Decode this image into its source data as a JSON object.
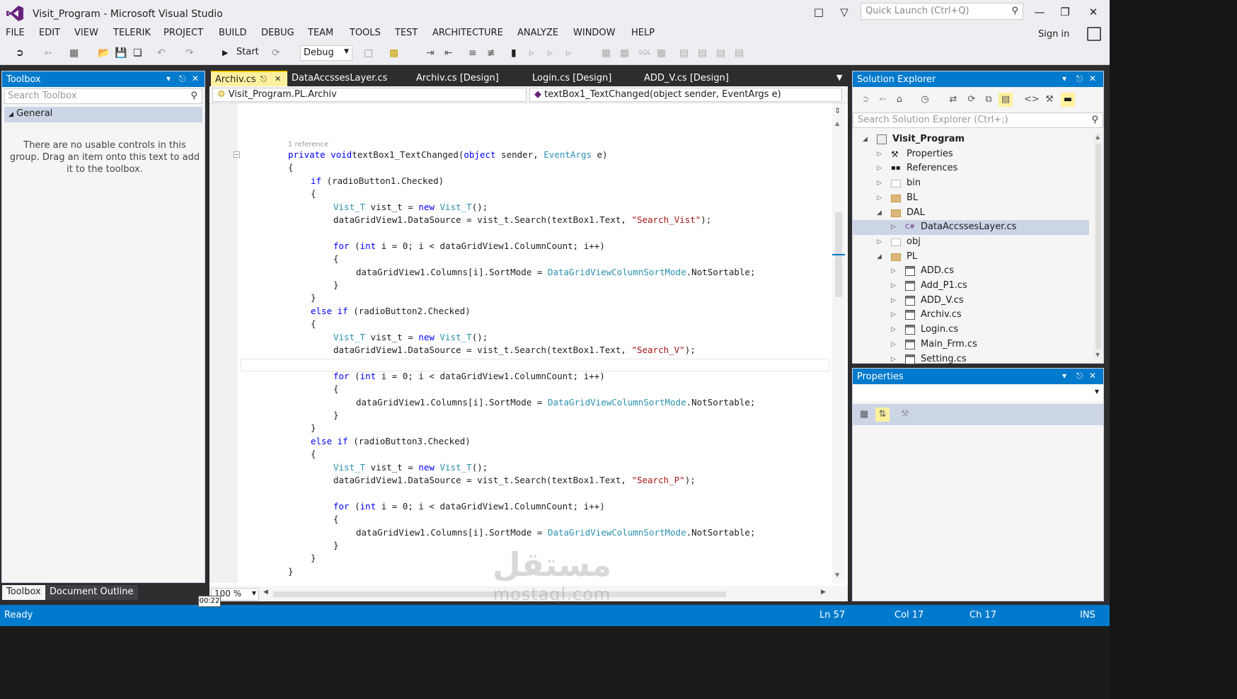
{
  "window": {
    "title": "Visit_Program - Microsoft Visual Studio",
    "quick_launch_placeholder": "Quick Launch (Ctrl+Q)",
    "sign_in": "Sign in"
  },
  "menu": [
    "FILE",
    "EDIT",
    "VIEW",
    "TELERIK",
    "PROJECT",
    "BUILD",
    "DEBUG",
    "TEAM",
    "TOOLS",
    "TEST",
    "ARCHITECTURE",
    "ANALYZE",
    "WINDOW",
    "HELP"
  ],
  "toolbar": {
    "start_label": "Start",
    "configuration": "Debug"
  },
  "toolbox": {
    "title": "Toolbox",
    "search_placeholder": "Search Toolbox",
    "group": "General",
    "empty_message": "There are no usable controls in this group. Drag an item onto this text to add it to the toolbox.",
    "bottom_tabs": [
      "Toolbox",
      "Document Outline"
    ]
  },
  "editor": {
    "tabs": [
      "Archiv.cs",
      "DataAccssesLayer.cs",
      "Archiv.cs [Design]",
      "Login.cs [Design]",
      "ADD_V.cs [Design]"
    ],
    "nav_left": "Visit_Program.PL.Archiv",
    "nav_right": "textBox1_TextChanged(object sender, EventArgs e)",
    "zoom": "100 %",
    "reference_hint": "1 reference"
  },
  "solution_explorer": {
    "title": "Solution Explorer",
    "search_placeholder": "Search Solution Explorer (Ctrl+;)",
    "items": [
      {
        "label": "Visit_Program",
        "level": 0,
        "kind": "solution",
        "state": "open"
      },
      {
        "label": "Properties",
        "level": 1,
        "kind": "wrench",
        "state": "closed"
      },
      {
        "label": "References",
        "level": 1,
        "kind": "refs",
        "state": "closed"
      },
      {
        "label": "bin",
        "level": 1,
        "kind": "folder-empty",
        "state": "closed"
      },
      {
        "label": "BL",
        "level": 1,
        "kind": "folder",
        "state": "closed"
      },
      {
        "label": "DAL",
        "level": 1,
        "kind": "folder-open",
        "state": "open"
      },
      {
        "label": "DataAccssesLayer.cs",
        "level": 2,
        "kind": "cs",
        "state": "closed"
      },
      {
        "label": "obj",
        "level": 1,
        "kind": "folder-empty",
        "state": "closed"
      },
      {
        "label": "PL",
        "level": 1,
        "kind": "folder-open",
        "state": "open"
      },
      {
        "label": "ADD.cs",
        "level": 2,
        "kind": "form",
        "state": "closed"
      },
      {
        "label": "Add_P1.cs",
        "level": 2,
        "kind": "form",
        "state": "closed"
      },
      {
        "label": "ADD_V.cs",
        "level": 2,
        "kind": "form",
        "state": "closed"
      },
      {
        "label": "Archiv.cs",
        "level": 2,
        "kind": "form",
        "state": "closed"
      },
      {
        "label": "Login.cs",
        "level": 2,
        "kind": "form",
        "state": "closed"
      },
      {
        "label": "Main_Frm.cs",
        "level": 2,
        "kind": "form",
        "state": "closed"
      },
      {
        "label": "Setting.cs",
        "level": 2,
        "kind": "form",
        "state": "closed"
      }
    ]
  },
  "properties": {
    "title": "Properties"
  },
  "status": {
    "ready": "Ready",
    "ln": "Ln 57",
    "col": "Col 17",
    "ch": "Ch 17",
    "mode": "INS",
    "timer": "00:22"
  },
  "watermark": {
    "arabic": "مستقل",
    "latin": "mostaql.com"
  },
  "colors": {
    "accent": "#007acc",
    "active_tab": "#fff0a0",
    "keyword": "#0000ff",
    "type": "#2b91af",
    "string": "#a31515"
  },
  "code_lines": [
    {
      "indent": 0,
      "segs": [
        [
          "k",
          "private"
        ],
        [
          "",
          ""
        ],
        [
          "k",
          "void"
        ],
        [
          "",
          "textBox1_TextChanged("
        ],
        [
          "k",
          "object"
        ],
        [
          "",
          " sender, "
        ],
        [
          "t",
          "EventArgs"
        ],
        [
          "",
          " e)"
        ]
      ]
    },
    {
      "indent": 0,
      "segs": [
        [
          "",
          "{"
        ]
      ]
    },
    {
      "indent": 1,
      "segs": [
        [
          "k",
          "if"
        ],
        [
          "",
          " (radioButton1.Checked)"
        ]
      ]
    },
    {
      "indent": 1,
      "segs": [
        [
          "",
          "{"
        ]
      ]
    },
    {
      "indent": 2,
      "segs": [
        [
          "t",
          "Vist_T"
        ],
        [
          "",
          " vist_t = "
        ],
        [
          "k",
          "new"
        ],
        [
          "",
          ""
        ],
        [
          "t",
          "Vist_T"
        ],
        [
          "",
          "();"
        ]
      ]
    },
    {
      "indent": 2,
      "segs": [
        [
          "",
          "dataGridView1.DataSource = vist_t.Search(textBox1.Text, "
        ],
        [
          "s",
          "\"Search_Vist\""
        ],
        [
          "",
          ");"
        ]
      ]
    },
    {
      "indent": 0,
      "segs": []
    },
    {
      "indent": 2,
      "segs": [
        [
          "k",
          "for"
        ],
        [
          "",
          " ("
        ],
        [
          "k",
          "int"
        ],
        [
          "",
          " i = 0; i < dataGridView1.ColumnCount; i++)"
        ]
      ]
    },
    {
      "indent": 2,
      "segs": [
        [
          "",
          "{"
        ]
      ]
    },
    {
      "indent": 3,
      "segs": [
        [
          "",
          "dataGridView1.Columns[i].SortMode = "
        ],
        [
          "t",
          "DataGridViewColumnSortMode"
        ],
        [
          "",
          ".NotSortable;"
        ]
      ]
    },
    {
      "indent": 2,
      "segs": [
        [
          "",
          "}"
        ]
      ]
    },
    {
      "indent": 1,
      "segs": [
        [
          "",
          "}"
        ]
      ]
    },
    {
      "indent": 1,
      "segs": [
        [
          "k",
          "else if"
        ],
        [
          "",
          " (radioButton2.Checked)"
        ]
      ]
    },
    {
      "indent": 1,
      "segs": [
        [
          "",
          "{"
        ]
      ]
    },
    {
      "indent": 2,
      "segs": [
        [
          "t",
          "Vist_T"
        ],
        [
          "",
          " vist_t = "
        ],
        [
          "k",
          "new"
        ],
        [
          "",
          ""
        ],
        [
          "t",
          "Vist_T"
        ],
        [
          "",
          "();"
        ]
      ]
    },
    {
      "indent": 2,
      "segs": [
        [
          "",
          "dataGridView1.DataSource = vist_t.Search(textBox1.Text, "
        ],
        [
          "s",
          "\"Search_V\""
        ],
        [
          "",
          ");"
        ]
      ]
    },
    {
      "indent": 0,
      "segs": []
    },
    {
      "indent": 2,
      "segs": [
        [
          "k",
          "for"
        ],
        [
          "",
          " ("
        ],
        [
          "k",
          "int"
        ],
        [
          "",
          " i = 0; i < dataGridView1.ColumnCount; i++)"
        ]
      ]
    },
    {
      "indent": 2,
      "segs": [
        [
          "",
          "{"
        ]
      ]
    },
    {
      "indent": 3,
      "segs": [
        [
          "",
          "dataGridView1.Columns[i].SortMode = "
        ],
        [
          "t",
          "DataGridViewColumnSortMode"
        ],
        [
          "",
          ".NotSortable;"
        ]
      ]
    },
    {
      "indent": 2,
      "segs": [
        [
          "",
          "}"
        ]
      ]
    },
    {
      "indent": 1,
      "segs": [
        [
          "",
          "}"
        ]
      ]
    },
    {
      "indent": 1,
      "segs": [
        [
          "k",
          "else if"
        ],
        [
          "",
          " (radioButton3.Checked)"
        ]
      ]
    },
    {
      "indent": 1,
      "segs": [
        [
          "",
          "{"
        ]
      ]
    },
    {
      "indent": 2,
      "segs": [
        [
          "t",
          "Vist_T"
        ],
        [
          "",
          " vist_t = "
        ],
        [
          "k",
          "new"
        ],
        [
          "",
          ""
        ],
        [
          "t",
          "Vist_T"
        ],
        [
          "",
          "();"
        ]
      ]
    },
    {
      "indent": 2,
      "segs": [
        [
          "",
          "dataGridView1.DataSource = vist_t.Search(textBox1.Text, "
        ],
        [
          "s",
          "\"Search_P\""
        ],
        [
          "",
          ");"
        ]
      ]
    },
    {
      "indent": 0,
      "segs": []
    },
    {
      "indent": 2,
      "segs": [
        [
          "k",
          "for"
        ],
        [
          "",
          " ("
        ],
        [
          "k",
          "int"
        ],
        [
          "",
          " i = 0; i < dataGridView1.ColumnCount; i++)"
        ]
      ]
    },
    {
      "indent": 2,
      "segs": [
        [
          "",
          "{"
        ]
      ]
    },
    {
      "indent": 3,
      "segs": [
        [
          "",
          "dataGridView1.Columns[i].SortMode = "
        ],
        [
          "t",
          "DataGridViewColumnSortMode"
        ],
        [
          "",
          ".NotSortable;"
        ]
      ]
    },
    {
      "indent": 2,
      "segs": [
        [
          "",
          "}"
        ]
      ]
    },
    {
      "indent": 1,
      "segs": [
        [
          "",
          "}"
        ]
      ]
    },
    {
      "indent": 0,
      "segs": [
        [
          "",
          "}"
        ]
      ]
    }
  ]
}
